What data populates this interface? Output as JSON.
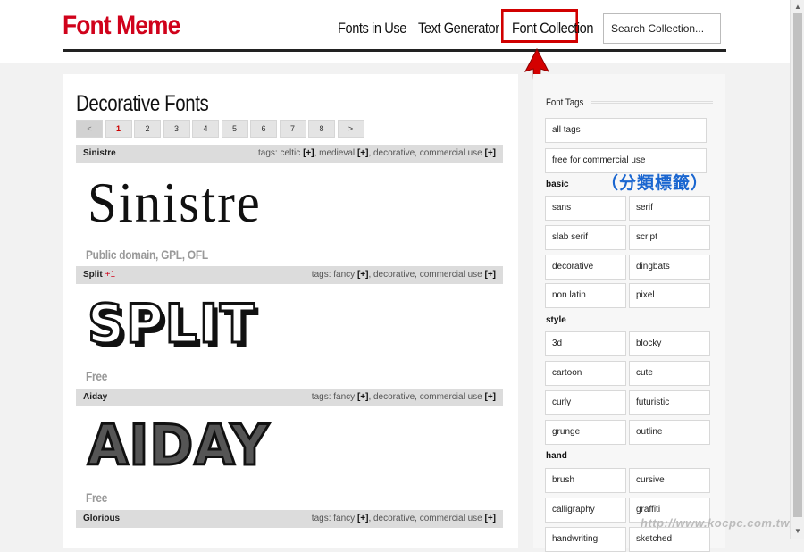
{
  "header": {
    "logo": "Font Meme",
    "nav": [
      "Fonts in Use",
      "Text Generator",
      "Font Collection"
    ],
    "search_placeholder": "Search Collection..."
  },
  "main": {
    "title": "Decorative Fonts",
    "pager": [
      "<",
      "1",
      "2",
      "3",
      "4",
      "5",
      "6",
      "7",
      "8",
      ">"
    ],
    "fonts": [
      {
        "name": "Sinistre",
        "plus": "",
        "tags_prefix": "tags: celtic",
        "tag2": "medieval",
        "tag3": "decorative, commercial use",
        "preview": "Sinistre",
        "license": "Public domain, GPL, OFL"
      },
      {
        "name": "Split",
        "plus": "+1",
        "tags_prefix": "tags: fancy",
        "tag2": "decorative, commercial use",
        "preview": "SPLIT",
        "license": "Free"
      },
      {
        "name": "Aiday",
        "plus": "",
        "tags_prefix": "tags: fancy",
        "tag2": "decorative, commercial use",
        "preview": "AIDAY",
        "license": "Free"
      },
      {
        "name": "Glorious",
        "plus": "",
        "tags_prefix": "tags: fancy",
        "tag2": "decorative, commercial use"
      }
    ],
    "bracket": "[+]"
  },
  "sidebar": {
    "title": "Font Tags",
    "all_tags": "all tags",
    "free_commercial": "free for commercial use",
    "annotation": "（分類標籤）",
    "groups": {
      "basic": {
        "label": "basic",
        "tags": [
          "sans",
          "serif",
          "slab serif",
          "script",
          "decorative",
          "dingbats",
          "non latin",
          "pixel"
        ]
      },
      "style": {
        "label": "style",
        "tags": [
          "3d",
          "blocky",
          "cartoon",
          "cute",
          "curly",
          "futuristic",
          "grunge",
          "outline"
        ]
      },
      "hand": {
        "label": "hand",
        "tags": [
          "brush",
          "cursive",
          "calligraphy",
          "graffiti",
          "handwriting",
          "sketched"
        ]
      }
    }
  },
  "colors": {
    "brand": "#d0021b",
    "annotation": "#1a66d0"
  },
  "watermark": "http://www.kocpc.com.tw/"
}
